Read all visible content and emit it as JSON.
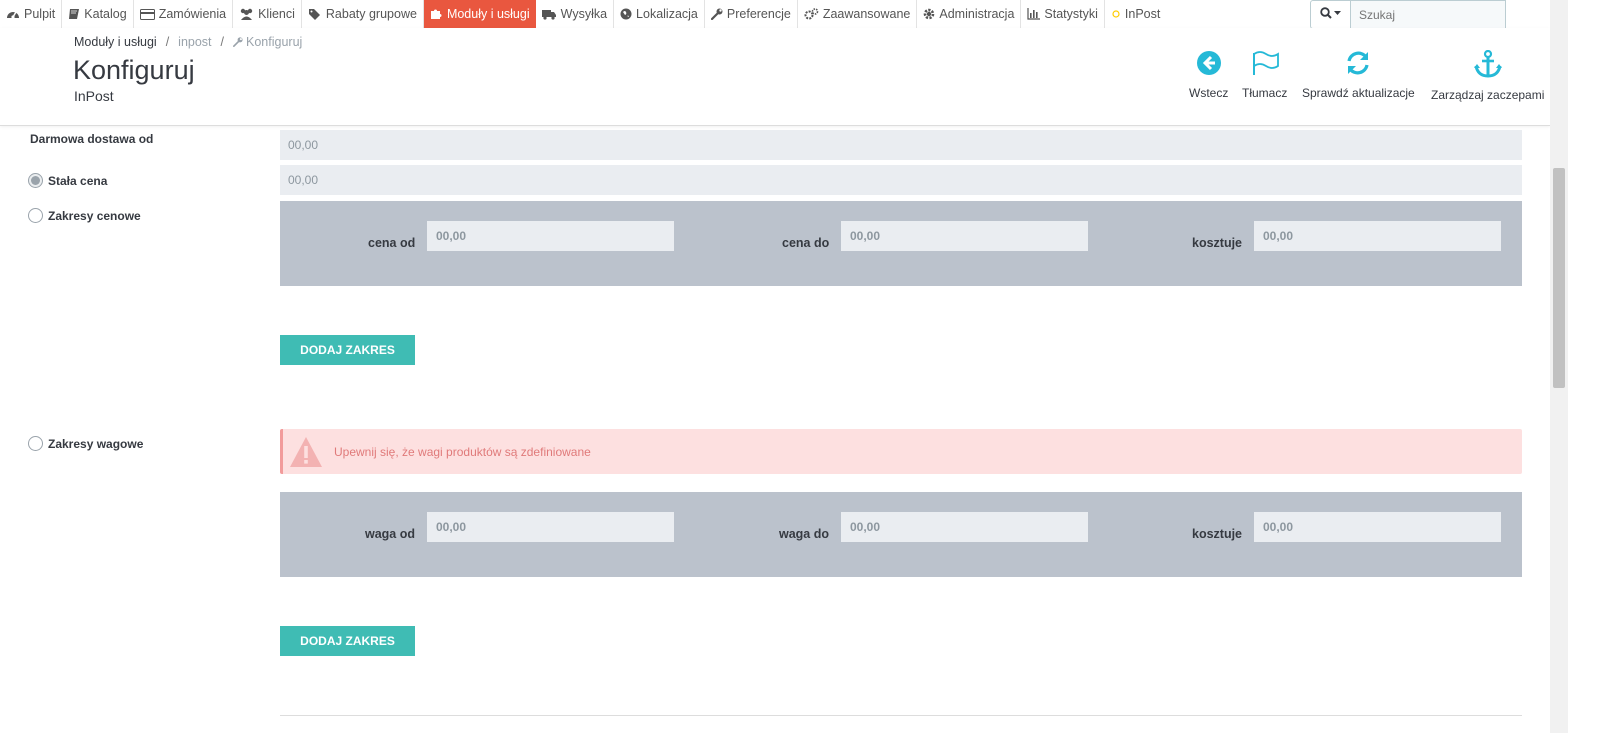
{
  "nav": {
    "items": [
      {
        "label": "Pulpit",
        "icon": "dashboard-icon"
      },
      {
        "label": "Katalog",
        "icon": "book-icon"
      },
      {
        "label": "Zamówienia",
        "icon": "credit-card-icon"
      },
      {
        "label": "Klienci",
        "icon": "users-icon"
      },
      {
        "label": "Rabaty grupowe",
        "icon": "tags-icon"
      },
      {
        "label": "Moduły i usługi",
        "icon": "puzzle-icon"
      },
      {
        "label": "Wysyłka",
        "icon": "truck-icon"
      },
      {
        "label": "Lokalizacja",
        "icon": "globe-icon"
      },
      {
        "label": "Preferencje",
        "icon": "wrench-icon"
      },
      {
        "label": "Zaawansowane",
        "icon": "cogs-icon"
      },
      {
        "label": "Administracja",
        "icon": "cog-icon"
      },
      {
        "label": "Statystyki",
        "icon": "bar-chart-icon"
      },
      {
        "label": "InPost",
        "icon": "inpost-icon"
      }
    ],
    "active_color": "#e9573f"
  },
  "search": {
    "placeholder": "Szukaj"
  },
  "breadcrumb": {
    "item1": "Moduły i usługi",
    "item2": "inpost",
    "item3": "Konfiguruj"
  },
  "page": {
    "title": "Konfiguruj",
    "subtitle": "InPost"
  },
  "toolbar": {
    "back": "Wstecz",
    "translate": "Tłumacz",
    "check_updates": "Sprawdź aktualizacje",
    "manage_hooks": "Zarządzaj zaczepami",
    "icon_color": "#25b9d7"
  },
  "form": {
    "free_shipping_label": "Darmowa dostawa od",
    "free_shipping_value": "00,00",
    "fixed_price_label": "Stała cena",
    "fixed_price_value": "00,00",
    "price_ranges_label": "Zakresy cenowe",
    "price_range": {
      "from_label": "cena od",
      "from_value": "00,00",
      "to_label": "cena do",
      "to_value": "00,00",
      "cost_label": "kosztuje",
      "cost_value": "00,00"
    },
    "add_range_label": "DODAJ ZAKRES",
    "weight_ranges_label": "Zakresy wagowe",
    "weight_alert": "Upewnij się, że wagi produktów są zdefiniowane",
    "weight_range": {
      "from_label": "waga od",
      "from_value": "00,00",
      "to_label": "waga do",
      "to_value": "00,00",
      "cost_label": "kosztuje",
      "cost_value": "00,00"
    },
    "add_range_label_2": "DODAJ ZAKRES",
    "button_color": "#3fbcb4",
    "alert_color": "#fde0e0"
  }
}
